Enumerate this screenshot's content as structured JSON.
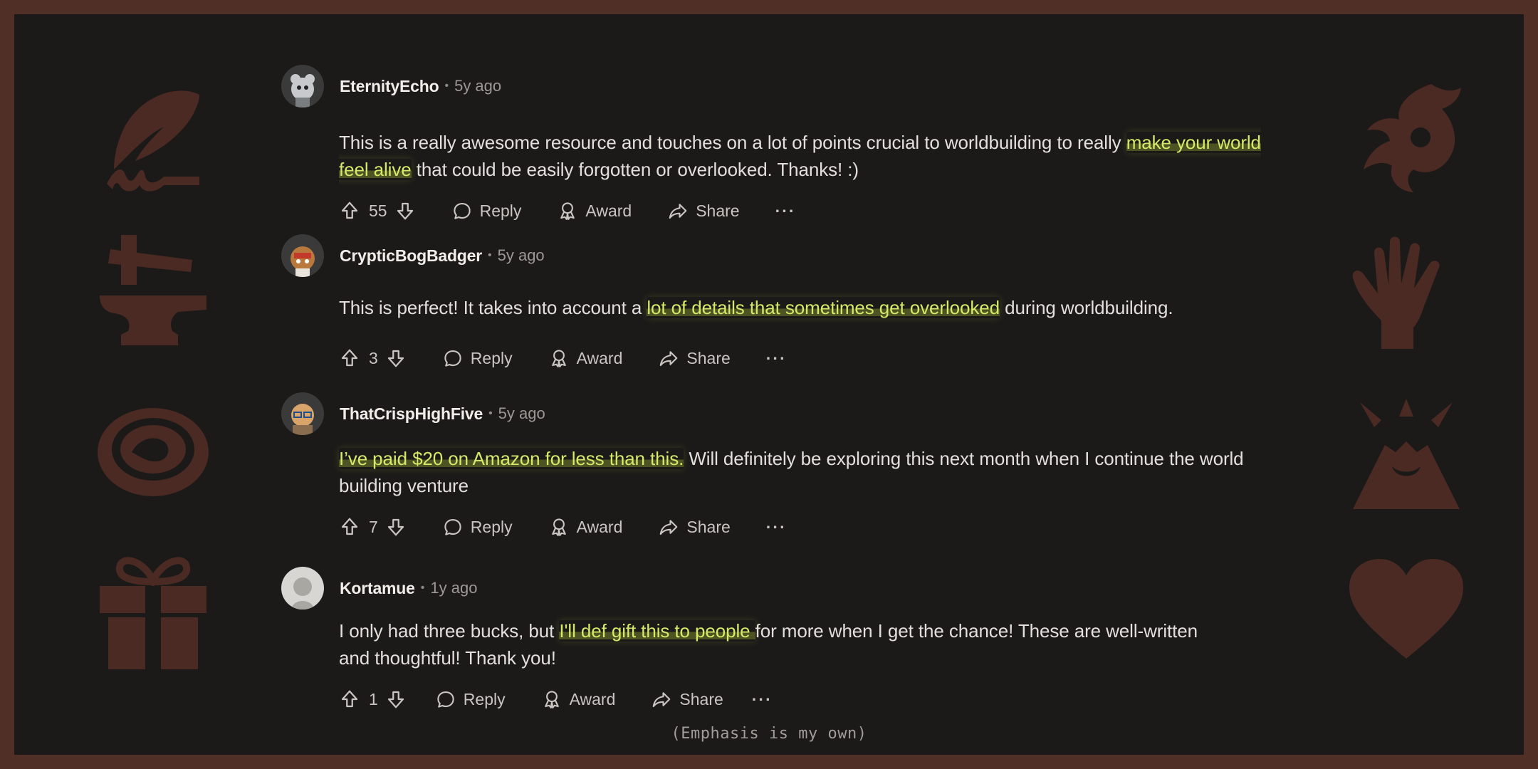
{
  "comments": [
    {
      "username": "EternityEcho",
      "age": "5y ago",
      "text_parts": [
        {
          "t": "This is a really awesome resource and touches on a lot of points crucial to worldbuilding to really ",
          "h": false
        },
        {
          "t": "make your world feel alive",
          "h": true
        },
        {
          "t": " that could be easily forgotten or overlooked. Thanks! :)",
          "h": false
        }
      ],
      "votes": "55"
    },
    {
      "username": "CrypticBogBadger",
      "age": "5y ago",
      "text_parts": [
        {
          "t": "This is perfect! It takes into account a ",
          "h": false
        },
        {
          "t": "lot of details that sometimes get overlooked",
          "h": true
        },
        {
          "t": " during worldbuilding.",
          "h": false
        }
      ],
      "votes": "3"
    },
    {
      "username": "ThatCrispHighFive",
      "age": "5y ago",
      "text_parts": [
        {
          "t": "I’ve paid $20 on Amazon for less than this.",
          "h": true
        },
        {
          "t": " Will definitely be exploring this next month when I continue the world building venture",
          "h": false
        }
      ],
      "votes": "7"
    },
    {
      "username": "Kortamue",
      "age": "1y ago",
      "text_parts": [
        {
          "t": "I only had three bucks, but ",
          "h": false
        },
        {
          "t": "I'll def gift this to people ",
          "h": true
        },
        {
          "t": "for more when I get the chance! These are well-written and thoughtful! Thank you!",
          "h": false
        }
      ],
      "votes": "1"
    }
  ],
  "actions": {
    "reply": "Reply",
    "award": "Award",
    "share": "Share",
    "more": "···"
  },
  "separator": "•",
  "caption": "(Emphasis is my own)",
  "colors": {
    "frame": "#4f2f26",
    "background": "#1b1a19",
    "highlight": "#d6ea6a",
    "decor": "#4a2a22"
  },
  "decor_icons": [
    "quill-signature-icon",
    "anvil-hammer-icon",
    "coin-icon",
    "gift-icon",
    "dragon-icon",
    "hand-icon",
    "volcano-icon",
    "heart-icon"
  ]
}
